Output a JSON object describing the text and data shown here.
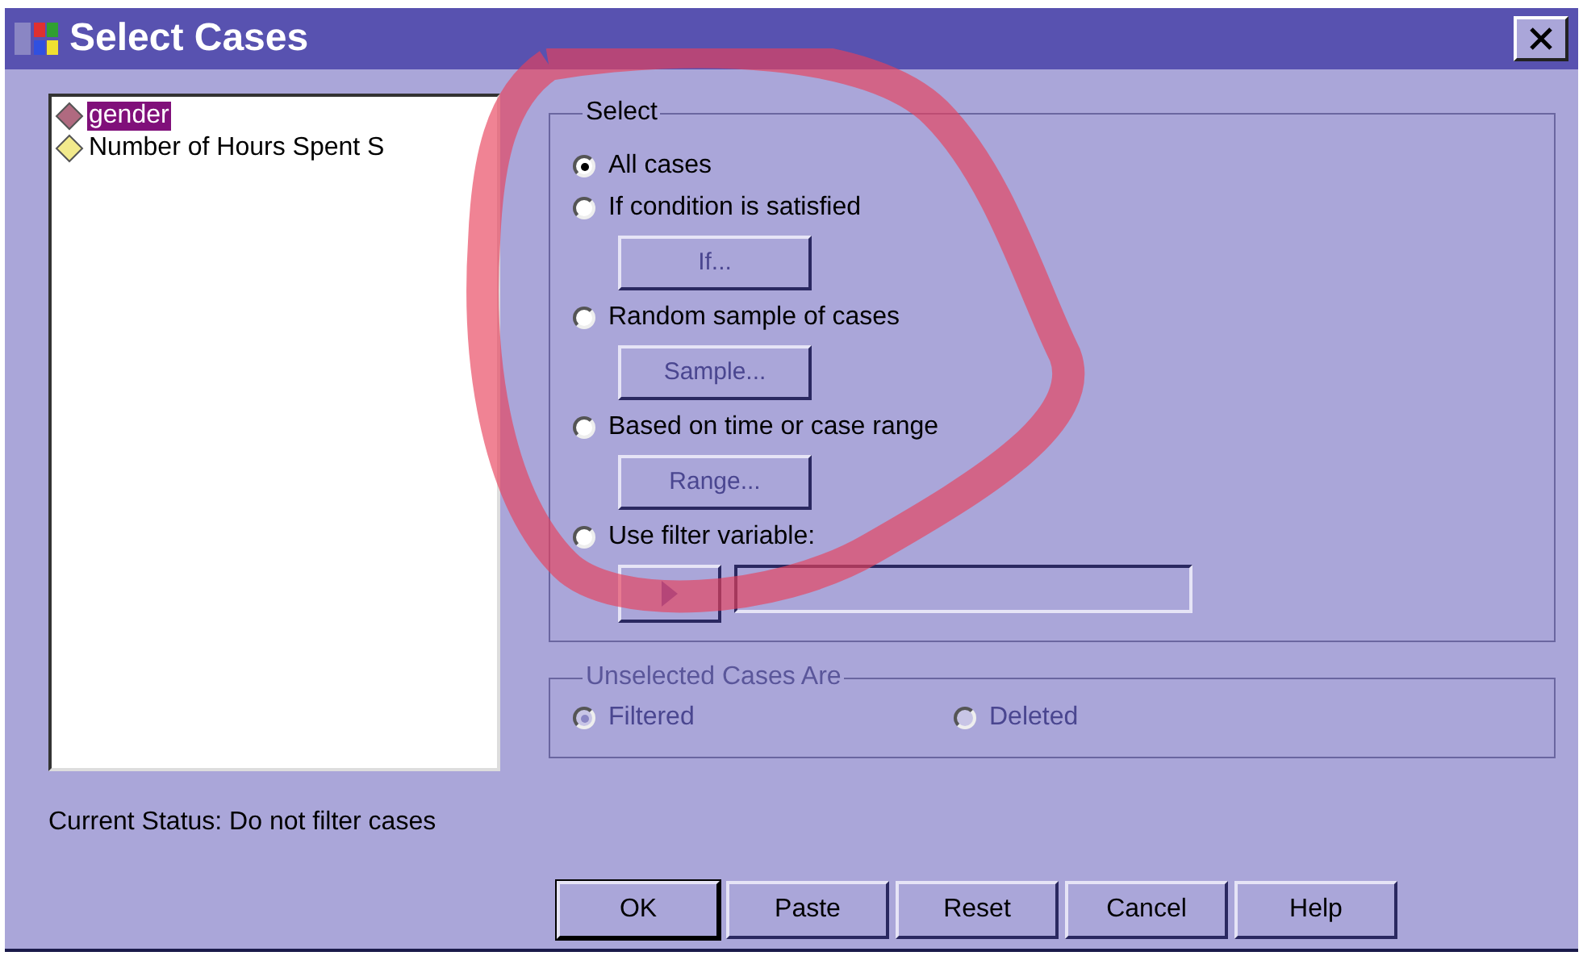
{
  "window": {
    "title": "Select Cases"
  },
  "variables": [
    {
      "label": "gender",
      "selected": true,
      "color": "#b06a80"
    },
    {
      "label": "Number of Hours Spent S",
      "selected": false,
      "color": "#f2ea8c"
    }
  ],
  "select_group": {
    "title": "Select",
    "options": [
      {
        "kind": "plain",
        "label": "All cases",
        "selected": true
      },
      {
        "kind": "button",
        "label": "If condition is satisfied",
        "selected": false,
        "button": {
          "label": "If...",
          "disabled": true
        }
      },
      {
        "kind": "button",
        "label": "Random sample of cases",
        "selected": false,
        "button": {
          "label": "Sample...",
          "disabled": true
        }
      },
      {
        "kind": "button",
        "label": "Based on time or case range",
        "selected": false,
        "button": {
          "label": "Range...",
          "disabled": true
        }
      },
      {
        "kind": "filter",
        "label": "Use filter variable:",
        "selected": false
      }
    ]
  },
  "unselected_group": {
    "title": "Unselected Cases Are",
    "disabled": true,
    "options": [
      {
        "label": "Filtered",
        "selected": true
      },
      {
        "label": "Deleted",
        "selected": false
      }
    ]
  },
  "status": "Current Status: Do not filter cases",
  "buttons": [
    {
      "label": "OK",
      "default": true
    },
    {
      "label": "Paste",
      "default": false
    },
    {
      "label": "Reset",
      "default": false
    },
    {
      "label": "Cancel",
      "default": false
    },
    {
      "label": "Help",
      "default": false
    }
  ]
}
